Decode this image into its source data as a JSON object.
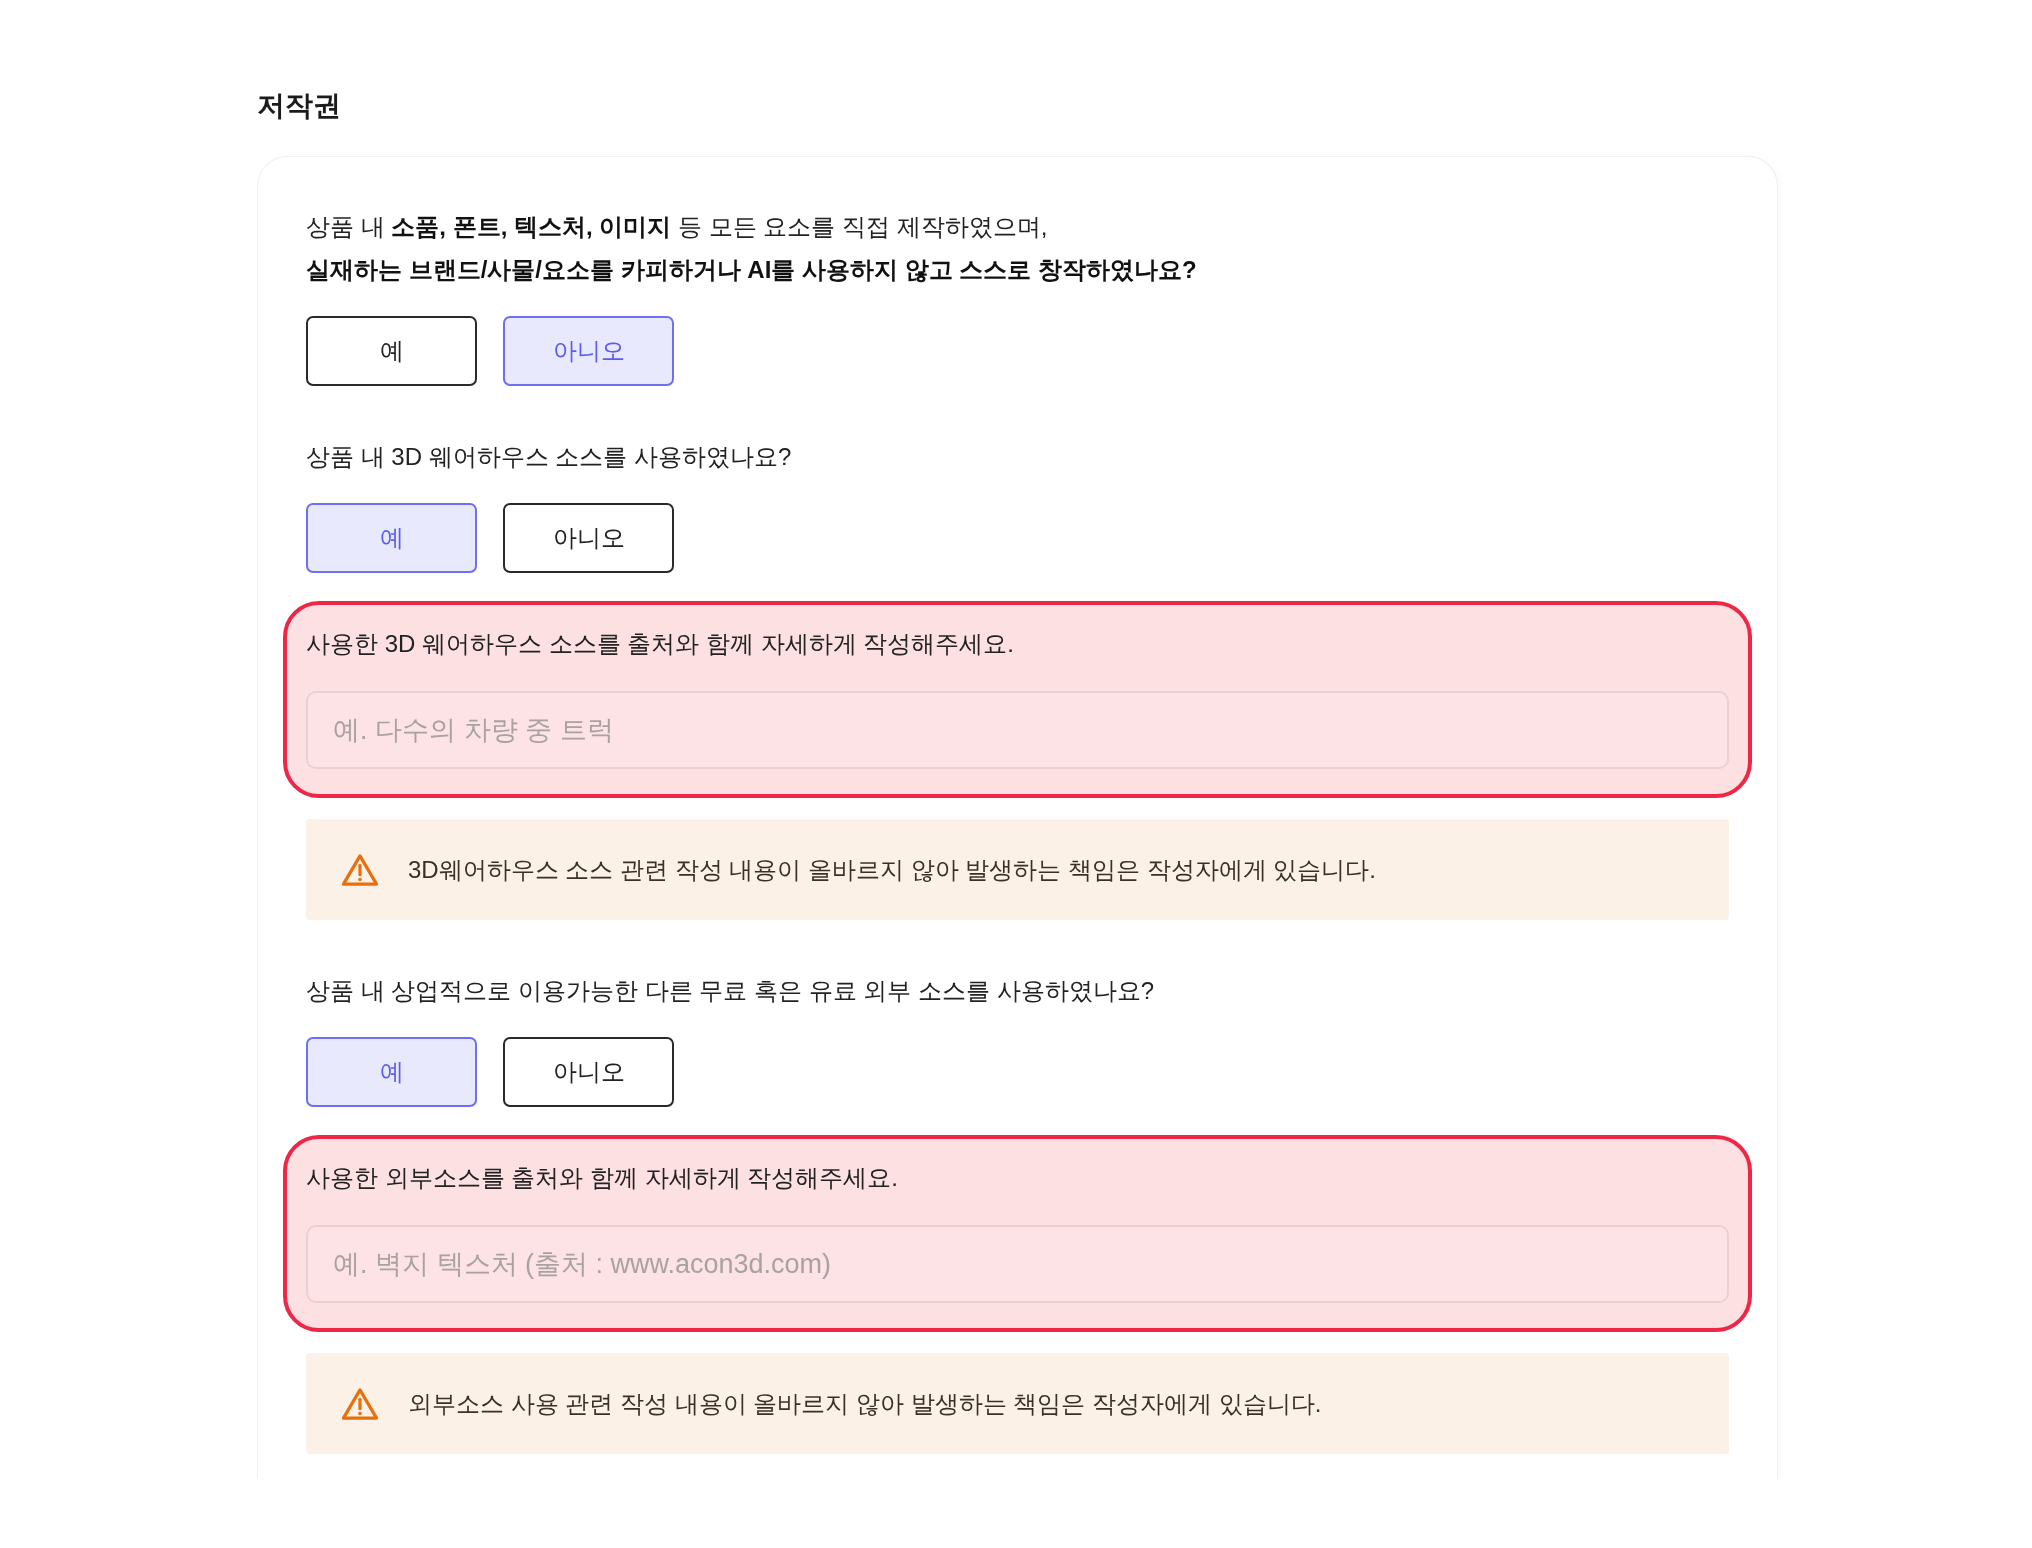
{
  "title": "저작권",
  "questions": [
    {
      "text": "상품 내 **소품, 폰트, 텍스처, 이미지** 등 모든 요소를 직접 제작하였으며,\n**실재하는 브랜드/사물/요소를 카피하거나 AI를 사용하지 않고 스스로 창작하였나요?**",
      "options": [
        {
          "label": "예",
          "selected": false
        },
        {
          "label": "아니오",
          "selected": true
        }
      ]
    },
    {
      "text": "상품 내 3D 웨어하우스 소스를 사용하였나요?",
      "options": [
        {
          "label": "예",
          "selected": true
        },
        {
          "label": "아니오",
          "selected": false
        }
      ],
      "detail": {
        "label": "사용한 3D 웨어하우스 소스를 출처와 함께 자세하게 작성해주세요.",
        "placeholder": "예. 다수의 차량 중 트럭",
        "highlighted": true
      },
      "notice": {
        "text": "3D웨어하우스 소스 관련 작성 내용이 올바르지 않아 발생하는 책임은 작성자에게 있습니다."
      }
    },
    {
      "text": "상품 내 상업적으로 이용가능한 다른 무료 혹은 유료 외부 소스를 사용하였나요?",
      "options": [
        {
          "label": "예",
          "selected": true
        },
        {
          "label": "아니오",
          "selected": false
        }
      ],
      "detail": {
        "label": "사용한 외부소스를 출처와 함께 자세하게 작성해주세요.",
        "placeholder": "예. 벽지 텍스처 (출처 : www.acon3d.com)",
        "highlighted": true
      },
      "notice": {
        "text": "외부소스 사용 관련 작성 내용이 올바르지 않아 발생하는 책임은 작성자에게 있습니다."
      }
    }
  ]
}
